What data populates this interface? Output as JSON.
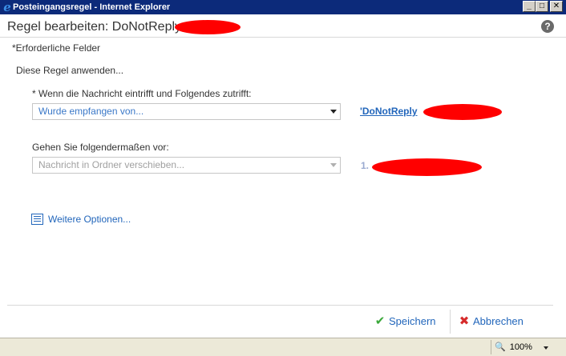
{
  "window": {
    "title": "Posteingangsregel - Internet Explorer",
    "minimize": "_",
    "maximize": "□",
    "close": "✕"
  },
  "dialog": {
    "title": "Regel bearbeiten: DoNotReply",
    "help": "?",
    "required_note": "*Erforderliche Felder",
    "rule_label": "Diese Regel anwenden..."
  },
  "condition": {
    "label": "* Wenn die Nachricht eintrifft und Folgendes zutrifft:",
    "selected": "Wurde empfangen von...",
    "value_link": "'DoNotReply"
  },
  "action": {
    "label": "Gehen Sie folgendermaßen vor:",
    "selected": "Nachricht in Ordner verschieben...",
    "value": "1."
  },
  "more_options": {
    "label": "Weitere Optionen...",
    "icon": "list-icon"
  },
  "footer": {
    "save_label": "Speichern",
    "save_icon": "✔",
    "cancel_label": "Abbrechen",
    "cancel_icon": "✖"
  },
  "statusbar": {
    "zoom": "100%"
  },
  "colors": {
    "link": "#2266bb",
    "titlebar": "#0c2a7a",
    "redaction": "#ff0000"
  }
}
